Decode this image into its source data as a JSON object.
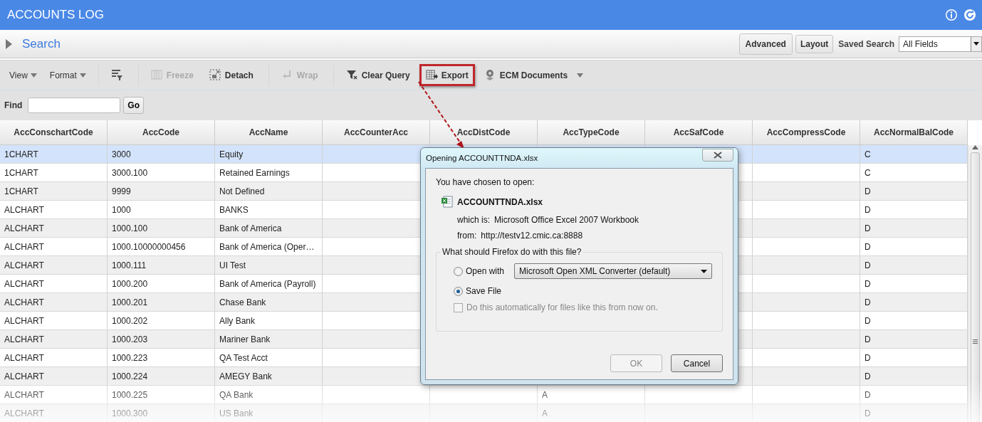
{
  "window": {
    "title": "ACCOUNTS LOG"
  },
  "search_bar": {
    "label": "Search",
    "buttons": [
      {
        "label": "Advanced"
      },
      {
        "label": "Layout"
      }
    ],
    "saved_search_label": "Saved Search",
    "saved_search_value": "All Fields"
  },
  "toolbar": [
    {
      "kind": "menu",
      "label": "View"
    },
    {
      "kind": "menu",
      "label": "Format"
    },
    {
      "kind": "icon"
    },
    {
      "kind": "button",
      "label": "Freeze",
      "disabled": true,
      "highlighted": false
    },
    {
      "kind": "button",
      "label": "Detach",
      "disabled": false,
      "highlighted": false
    },
    {
      "kind": "button",
      "label": "Wrap",
      "disabled": true,
      "highlighted": false
    },
    {
      "kind": "button",
      "label": "Clear Query",
      "disabled": false,
      "highlighted": false
    },
    {
      "kind": "button",
      "label": "Export",
      "disabled": false,
      "highlighted": true
    },
    {
      "kind": "dropdown",
      "label": "ECM Documents",
      "disabled": false,
      "highlighted": false
    }
  ],
  "find": {
    "label": "Find",
    "button": "Go"
  },
  "table": {
    "columns": [
      "AccConschartCode",
      "AccCode",
      "AccName",
      "AccCounterAcc",
      "AccDistCode",
      "AccTypeCode",
      "AccSafCode",
      "AccCompressCode",
      "AccNormalBalCode"
    ],
    "rows": [
      {
        "selected": true,
        "chart": "1CHART",
        "code": "3000",
        "name": "Equity",
        "normal_bal": "C"
      },
      {
        "selected": false,
        "chart": "1CHART",
        "code": "3000.100",
        "name": "Retained Earnings",
        "normal_bal": "C"
      },
      {
        "selected": false,
        "chart": "1CHART",
        "code": "9999",
        "name": "Not Defined",
        "normal_bal": "D"
      },
      {
        "selected": false,
        "chart": "ALCHART",
        "code": "1000",
        "name": "BANKS",
        "normal_bal": "D"
      },
      {
        "selected": false,
        "chart": "ALCHART",
        "code": "1000.100",
        "name": "Bank of America",
        "normal_bal": "D"
      },
      {
        "selected": false,
        "chart": "ALCHART",
        "code": "1000.10000000456",
        "name": "Bank of America (Oper…",
        "normal_bal": "D"
      },
      {
        "selected": false,
        "chart": "ALCHART",
        "code": "1000.111",
        "name": "UI Test",
        "normal_bal": "D"
      },
      {
        "selected": false,
        "chart": "ALCHART",
        "code": "1000.200",
        "name": "Bank of America (Payroll)",
        "normal_bal": "D"
      },
      {
        "selected": false,
        "chart": "ALCHART",
        "code": "1000.201",
        "name": "Chase Bank",
        "normal_bal": "D"
      },
      {
        "selected": false,
        "chart": "ALCHART",
        "code": "1000.202",
        "name": "Ally Bank",
        "normal_bal": "D"
      },
      {
        "selected": false,
        "chart": "ALCHART",
        "code": "1000.203",
        "name": "Mariner Bank",
        "normal_bal": "D"
      },
      {
        "selected": false,
        "chart": "ALCHART",
        "code": "1000.223",
        "name": "QA Test Acct",
        "normal_bal": "D"
      },
      {
        "selected": false,
        "chart": "ALCHART",
        "code": "1000.224",
        "name": "AMEGY Bank",
        "normal_bal": "D"
      },
      {
        "selected": false,
        "chart": "ALCHART",
        "code": "1000.225",
        "name": "QA Bank",
        "type": "A",
        "normal_bal": "D"
      },
      {
        "selected": false,
        "chart": "ALCHART",
        "code": "1000.300",
        "name": "US Bank",
        "type": "A",
        "normal_bal": "D"
      }
    ]
  },
  "dialog": {
    "title": "Opening ACCOUNTTNDA.xlsx",
    "heading": "You have chosen to open:",
    "file_name": "ACCOUNTTNDA.xlsx",
    "type_label": "which is:",
    "type_value": "Microsoft Office Excel 2007 Workbook",
    "from_label": "from:",
    "from_value": "http://testv12.cmic.ca:8888",
    "group_title": "What should Firefox do with this file?",
    "options": [
      {
        "label": "Open with",
        "selected": false
      },
      {
        "label": "Save File",
        "selected": true
      }
    ],
    "app_select": "Microsoft Open XML Converter (default)",
    "auto_checkbox": {
      "label": "Do this automatically for files like this from now on.",
      "checked": false,
      "disabled": true
    },
    "buttons": [
      {
        "label": "OK",
        "disabled": true
      },
      {
        "label": "Cancel",
        "disabled": false
      }
    ]
  }
}
